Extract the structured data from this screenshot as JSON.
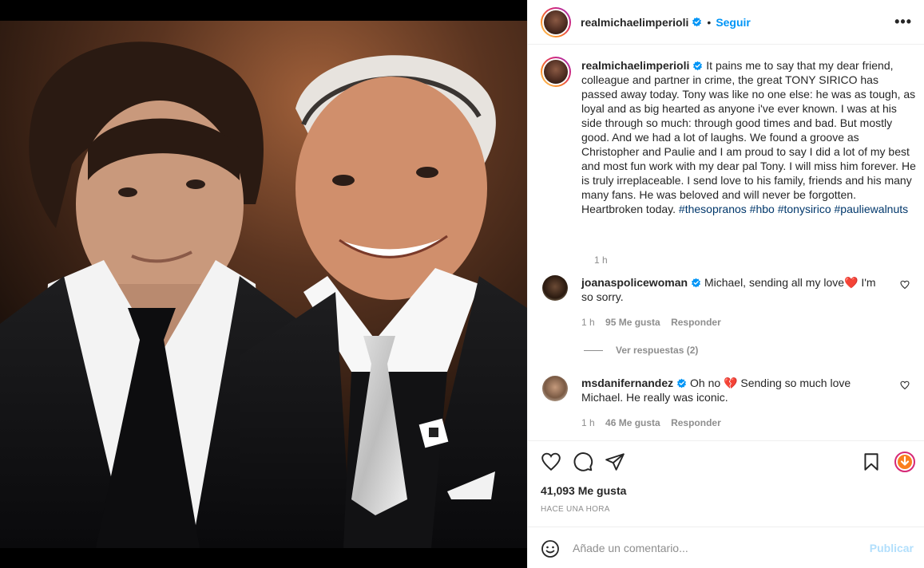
{
  "header": {
    "username": "realmichaelimperioli",
    "dot": "•",
    "follow_label": "Seguir",
    "more_label": "•••"
  },
  "caption": {
    "username": "realmichaelimperioli",
    "text": "It pains me to say that my dear friend, colleague and partner in crime, the great TONY SIRICO has passed away today. Tony was like no one else: he was as tough, as loyal and as big hearted as anyone i've ever known. I was at his side through so much: through good times and bad. But mostly good. And we had a lot of laughs. We found a groove as Christopher and Paulie and I am proud to say I did a lot of my best and most fun work with my dear pal Tony. I will miss him forever. He is truly irreplaceable. I send love to his family, friends and his many many fans. He was beloved and will never be forgotten. Heartbroken today.",
    "hashtags": [
      "#thesopranos",
      "#hbo",
      "#tonysirico",
      "#pauliewalnuts"
    ],
    "time": "1 h"
  },
  "comments": [
    {
      "username": "joanaspolicewoman",
      "text_before": "Michael, sending all my love",
      "emoji": "❤️",
      "text_after": " I'm so sorry.",
      "time": "1 h",
      "likes": "95 Me gusta",
      "reply_label": "Responder"
    },
    {
      "username": "msdanifernandez",
      "text_before": "Oh no ",
      "emoji": "💔",
      "text_after": " Sending so much love Michael. He really was iconic.",
      "time": "1 h",
      "likes": "46 Me gusta",
      "reply_label": "Responder"
    }
  ],
  "replies_label": "Ver respuestas (2)",
  "likes_count": "41,093 Me gusta",
  "posted_ago": "HACE UNA HORA",
  "add_comment": {
    "placeholder": "Añade un comentario...",
    "publish_label": "Publicar"
  },
  "colors": {
    "accent": "#0095f6",
    "publish_disabled": "#b2dffc",
    "hashtag": "#00376b",
    "muted": "#8e8e8e",
    "text": "#262626"
  }
}
